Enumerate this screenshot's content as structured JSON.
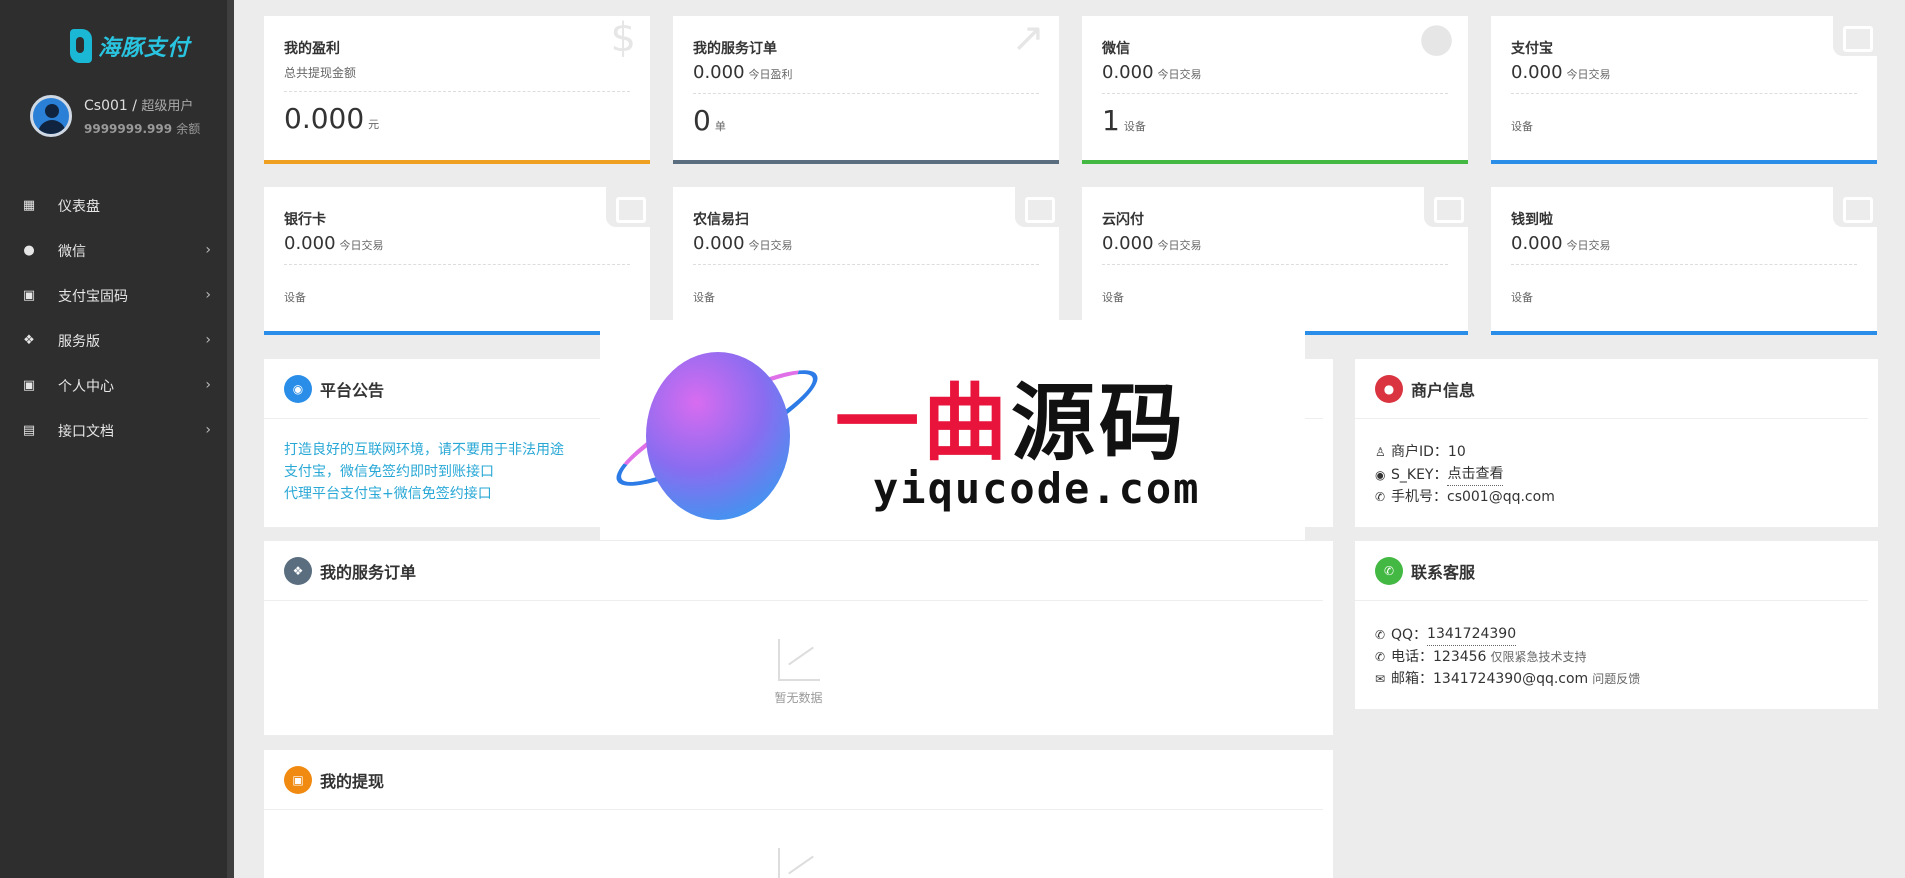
{
  "brand": {
    "logo_text": "海豚支付"
  },
  "user": {
    "name": "Cs001",
    "separator": " / ",
    "role": "超级用户",
    "balance": "9999999.999",
    "balance_unit": "余额"
  },
  "sidebar": {
    "items": [
      {
        "label": "仪表盘",
        "icon": "dashboard-icon"
      },
      {
        "label": "微信",
        "icon": "wechat-icon"
      },
      {
        "label": "支付宝固码",
        "icon": "wallet-icon"
      },
      {
        "label": "服务版",
        "icon": "service-icon"
      },
      {
        "label": "个人中心",
        "icon": "wallet-icon"
      },
      {
        "label": "接口文档",
        "icon": "docs-icon"
      }
    ],
    "chevron": "›"
  },
  "stats": {
    "profit": {
      "title": "我的盈利",
      "sub": "总共提现金额",
      "value": "0.000",
      "unit": "元"
    },
    "orders": {
      "title": "我的服务订单",
      "value": "0.000",
      "value_label": "今日盈利",
      "big": "0",
      "big_unit": "单"
    },
    "wechat": {
      "title": "微信",
      "value": "0.000",
      "value_label": "今日交易",
      "big": "1",
      "big_unit": "设备"
    },
    "alipay": {
      "title": "支付宝",
      "value": "0.000",
      "value_label": "今日交易",
      "device": "设备"
    },
    "bank": {
      "title": "银行卡",
      "value": "0.000",
      "value_label": "今日交易",
      "device": "设备"
    },
    "nongxin": {
      "title": "农信易扫",
      "value": "0.000",
      "value_label": "今日交易",
      "device": "设备"
    },
    "yunshanfu": {
      "title": "云闪付",
      "value": "0.000",
      "value_label": "今日交易",
      "device": "设备"
    },
    "qiandaola": {
      "title": "钱到啦",
      "value": "0.000",
      "value_label": "今日交易",
      "device": "设备"
    }
  },
  "notice": {
    "title": "平台公告",
    "lines": [
      "打造良好的互联网环境，请不要用于非法用途",
      "支付宝，微信免签约即时到账接口",
      "代理平台支付宝+微信免签约接口"
    ]
  },
  "merchant": {
    "title": "商户信息",
    "id_label": "商户ID：",
    "id_value": "10",
    "skey_label": "S_KEY：",
    "skey_link": "点击查看",
    "phone_label": "手机号：",
    "phone_value": "cs001@qq.com"
  },
  "service_orders": {
    "title": "我的服务订单",
    "empty": "暂无数据"
  },
  "support": {
    "title": "联系客服",
    "qq_label": "QQ：",
    "qq_value": "1341724390",
    "tel_label": "电话：",
    "tel_value": "123456",
    "tel_note": "仅限紧急技术支持",
    "mail_label": "邮箱：",
    "mail_value": "1341724390@qq.com",
    "mail_note": "问题反馈"
  },
  "withdraw": {
    "title": "我的提现"
  },
  "watermark": {
    "cn_red": "一曲",
    "cn_black": "源码",
    "en": "yiqucode.com"
  },
  "colors": {
    "orange": "#f0a020",
    "slate": "#5a6e80",
    "green": "#43b843",
    "blue": "#2a8ee8",
    "red": "#d9343f",
    "accent_cyan": "#29a8d6"
  }
}
